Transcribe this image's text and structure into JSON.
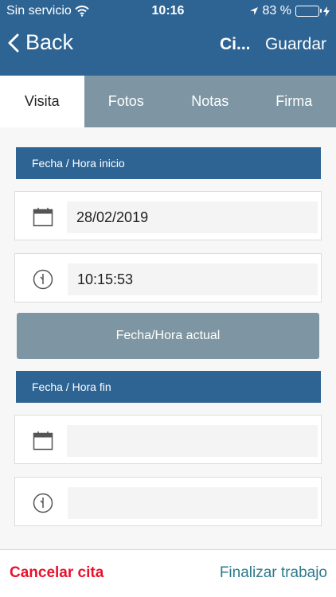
{
  "status_bar": {
    "carrier": "Sin servicio",
    "time": "10:16",
    "battery_percent": "83 %",
    "battery_level": 0.83
  },
  "nav": {
    "back_label": "Back",
    "title": "Ci...",
    "save_label": "Guardar"
  },
  "tabs": [
    {
      "label": "Visita",
      "active": true
    },
    {
      "label": "Fotos",
      "active": false
    },
    {
      "label": "Notas",
      "active": false
    },
    {
      "label": "Firma",
      "active": false
    }
  ],
  "start": {
    "header": "Fecha / Hora inicio",
    "date_value": "28/02/2019",
    "time_value": "10:15:53"
  },
  "now_button_label": "Fecha/Hora actual",
  "end": {
    "header": "Fecha / Hora fin",
    "date_value": "",
    "time_value": ""
  },
  "footer": {
    "cancel_label": "Cancelar cita",
    "finish_label": "Finalizar trabajo"
  },
  "colors": {
    "primary": "#2e6494",
    "secondary": "#7e96a3",
    "cancel": "#e8112d",
    "finish": "#2e7a8c",
    "battery": "#4cd964"
  }
}
